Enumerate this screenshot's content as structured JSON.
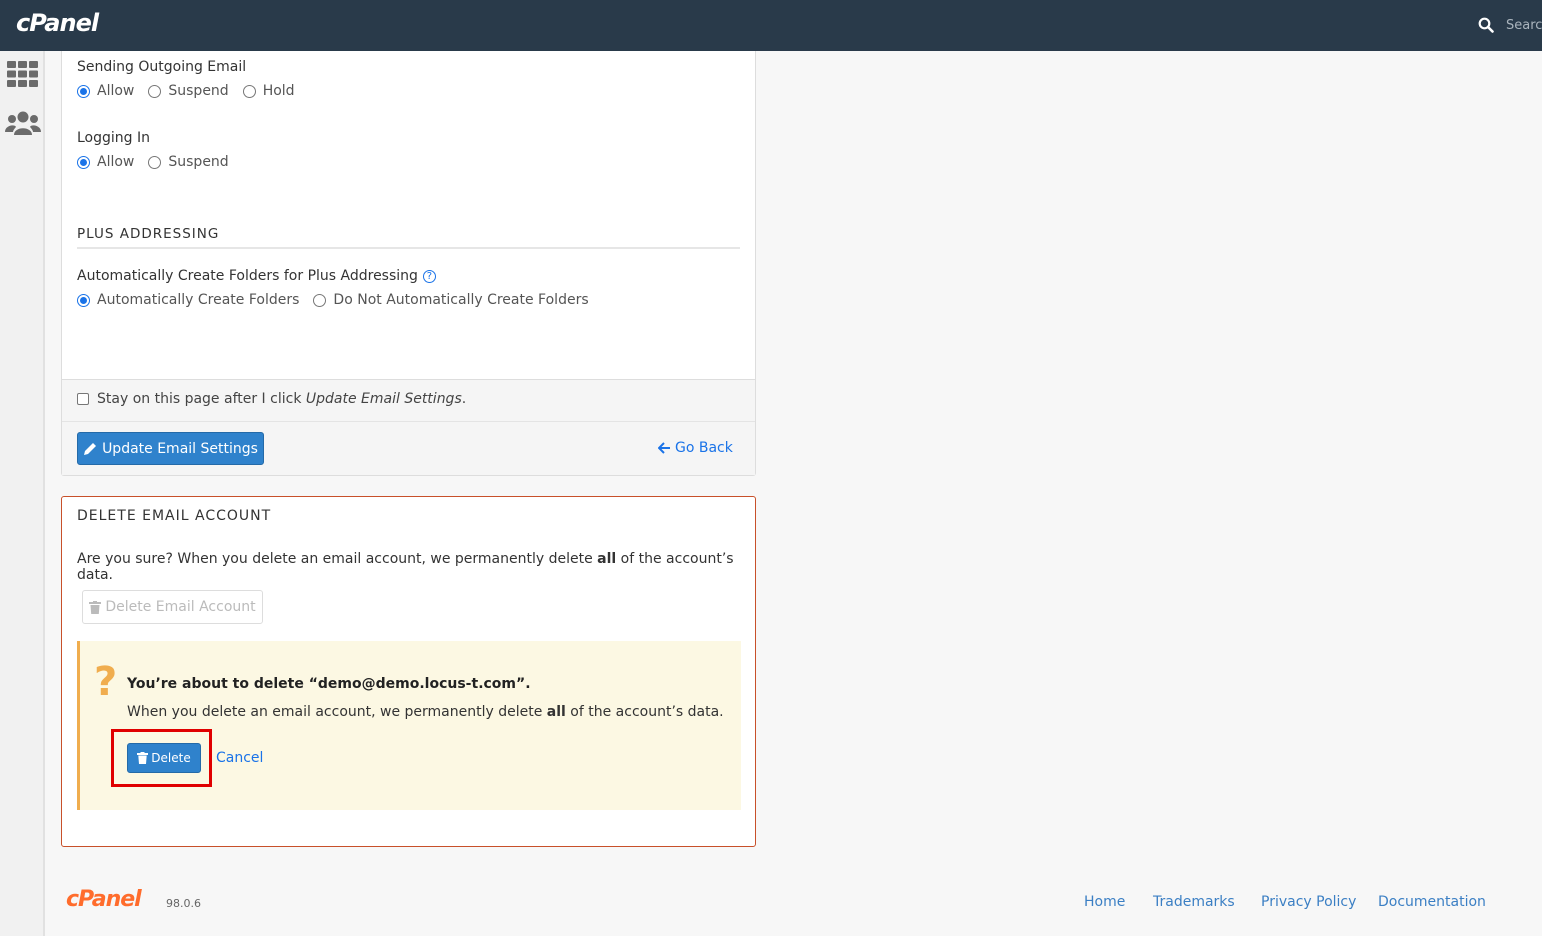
{
  "header": {
    "logo": "cPanel",
    "search_placeholder": "Search"
  },
  "sidebar": {
    "items": [
      {
        "icon": "grid-icon"
      },
      {
        "icon": "users-icon"
      }
    ]
  },
  "settings": {
    "sending_outgoing": {
      "label": "Sending Outgoing Email",
      "options": [
        "Allow",
        "Suspend",
        "Hold"
      ],
      "selected": "Allow"
    },
    "logging_in": {
      "label": "Logging In",
      "options": [
        "Allow",
        "Suspend"
      ],
      "selected": "Allow"
    },
    "plus_addressing": {
      "heading": "PLUS ADDRESSING",
      "label": "Automatically Create Folders for Plus Addressing",
      "options": [
        "Automatically Create Folders",
        "Do Not Automatically Create Folders"
      ],
      "selected": "Automatically Create Folders"
    },
    "stay_on_page": {
      "text_prefix": "Stay on this page after I click ",
      "text_em": "Update Email Settings",
      "text_suffix": ".",
      "checked": false
    },
    "update_button": "Update Email Settings",
    "go_back": "Go Back"
  },
  "delete_section": {
    "title": "DELETE EMAIL ACCOUNT",
    "text_prefix": "Are you sure? When you delete an email account, we permanently delete ",
    "text_bold": "all",
    "text_suffix": " of the account’s data.",
    "disabled_button": "Delete Email Account",
    "confirm": {
      "title": "You’re about to delete “demo@demo.locus-t.com”.",
      "text_prefix": "When you delete an email account, we permanently delete ",
      "text_bold": "all",
      "text_suffix": " of the account’s data.",
      "delete_button": "Delete",
      "cancel": "Cancel"
    }
  },
  "footer": {
    "logo": "cPanel",
    "version": "98.0.6",
    "links": [
      "Home",
      "Trademarks",
      "Privacy Policy",
      "Documentation"
    ]
  },
  "colors": {
    "topbar": "#293a4a",
    "primary": "#2f82cc",
    "link": "#1a73e8",
    "danger_border": "#c8502a",
    "warning_bg": "#fcf8e3",
    "warning_accent": "#f0ad4e",
    "highlight": "#e00000",
    "brand_orange": "#ff6c2c"
  }
}
